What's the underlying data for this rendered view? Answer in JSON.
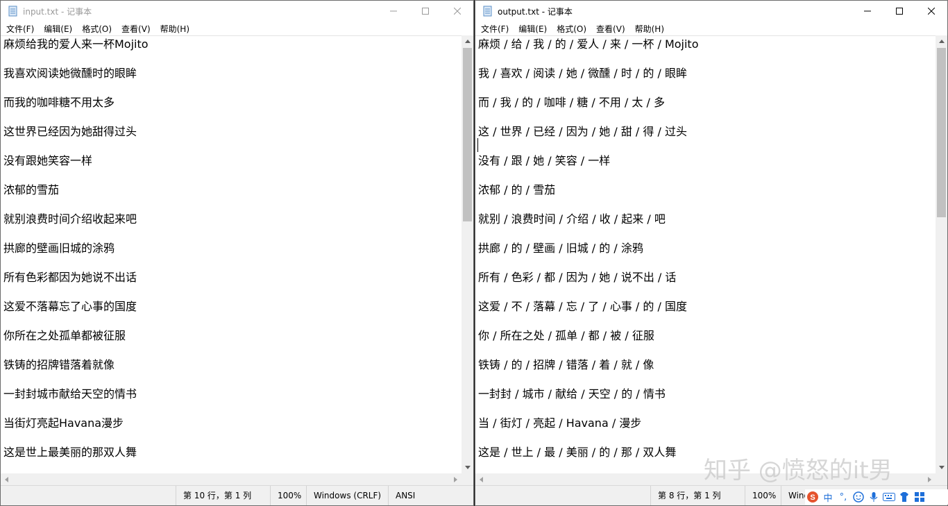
{
  "left_window": {
    "title": "input.txt - 记事本",
    "menu": [
      "文件(F)",
      "编辑(E)",
      "格式(O)",
      "查看(V)",
      "帮助(H)"
    ],
    "lines": [
      "麻烦给我的爱人来一杯Mojito",
      "我喜欢阅读她微醺时的眼眸",
      "而我的咖啡糖不用太多",
      "这世界已经因为她甜得过头",
      "没有跟她笑容一样",
      "浓郁的雪茄",
      "就别浪费时间介绍收起来吧",
      "拱廊的壁画旧城的涂鸦",
      "所有色彩都因为她说不出话",
      "这爱不落幕忘了心事的国度",
      "你所在之处孤单都被征服",
      "铁铸的招牌错落着就像",
      "一封封城市献给天空的情书",
      "当街灯亮起Havana漫步",
      "这是世上最美丽的那双人舞"
    ],
    "status": {
      "position": "第 10 行，第 1 列",
      "zoom": "100%",
      "line_ending": "Windows (CRLF)",
      "encoding": "ANSI"
    }
  },
  "right_window": {
    "title": "output.txt - 记事本",
    "menu": [
      "文件(F)",
      "编辑(E)",
      "格式(O)",
      "查看(V)",
      "帮助(H)"
    ],
    "lines": [
      "麻烦 / 给 / 我 / 的 / 爱人 / 来 / 一杯 / Mojito",
      "我 / 喜欢 / 阅读 / 她 / 微醺 / 时 / 的 / 眼眸",
      "而 / 我 / 的 / 咖啡 / 糖 / 不用 / 太 / 多",
      "这 / 世界 / 已经 / 因为 / 她 / 甜 / 得 / 过头",
      "没有 / 跟 / 她 / 笑容 / 一样",
      "浓郁 / 的 / 雪茄",
      "就别 / 浪费时间 / 介绍 / 收 / 起来 / 吧",
      "拱廊 / 的 / 壁画 / 旧城 / 的 / 涂鸦",
      "所有 / 色彩 / 都 / 因为 / 她 / 说不出 / 话",
      "这爱 / 不 / 落幕 / 忘 / 了 / 心事 / 的 / 国度",
      "你 / 所在之处 / 孤单 / 都 / 被 / 征服",
      "铁铸 / 的 / 招牌 / 错落 / 着 / 就 / 像",
      "一封封 / 城市 / 献给 / 天空 / 的 / 情书",
      "当 / 街灯 / 亮起 / Havana / 漫步",
      "这是 / 世上 / 最 / 美丽 / 的 / 那 / 双人舞"
    ],
    "status": {
      "position": "第 8 行，第 1 列",
      "zoom": "100%",
      "line_ending": "Windo"
    }
  },
  "watermark": "知乎 @愤怒的it男",
  "ime": {
    "logo": "S",
    "lang": "中",
    "punct": "°,"
  },
  "colors": {
    "thumb": "#c1c1c1",
    "statusbar": "#f0f0f0",
    "ime_logo": "#e5532d"
  }
}
